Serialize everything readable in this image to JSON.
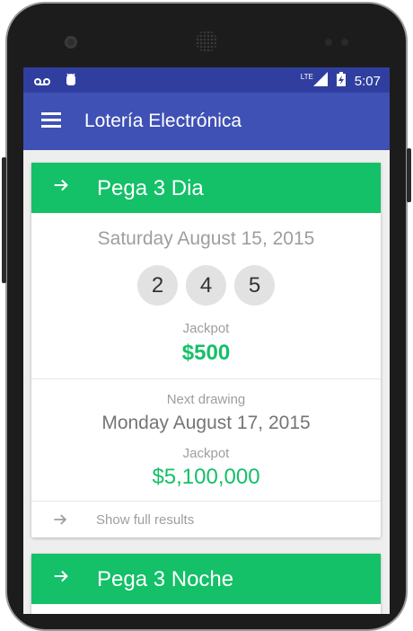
{
  "status_bar": {
    "time": "5:07",
    "network": "LTE",
    "icons": [
      "voicemail-icon",
      "android-debug-icon",
      "signal-icon",
      "battery-icon"
    ]
  },
  "app_bar": {
    "title": "Lotería Electrónica",
    "menu_icon": "hamburger-menu-icon"
  },
  "colors": {
    "status_bar": "#303f9f",
    "app_bar": "#3f51b5",
    "card_header": "#14c068",
    "accent_green": "#14c068"
  },
  "cards": [
    {
      "game_name": "Pega 3 Dia",
      "draw_date": "Saturday August 15, 2015",
      "numbers": [
        "2",
        "4",
        "5"
      ],
      "jackpot_label": "Jackpot",
      "jackpot": "$500",
      "next_drawing_label": "Next drawing",
      "next_date": "Monday August 17, 2015",
      "next_jackpot_label": "Jackpot",
      "next_jackpot": "$5,100,000",
      "full_results_label": "Show full results"
    },
    {
      "game_name": "Pega 3 Noche"
    }
  ]
}
